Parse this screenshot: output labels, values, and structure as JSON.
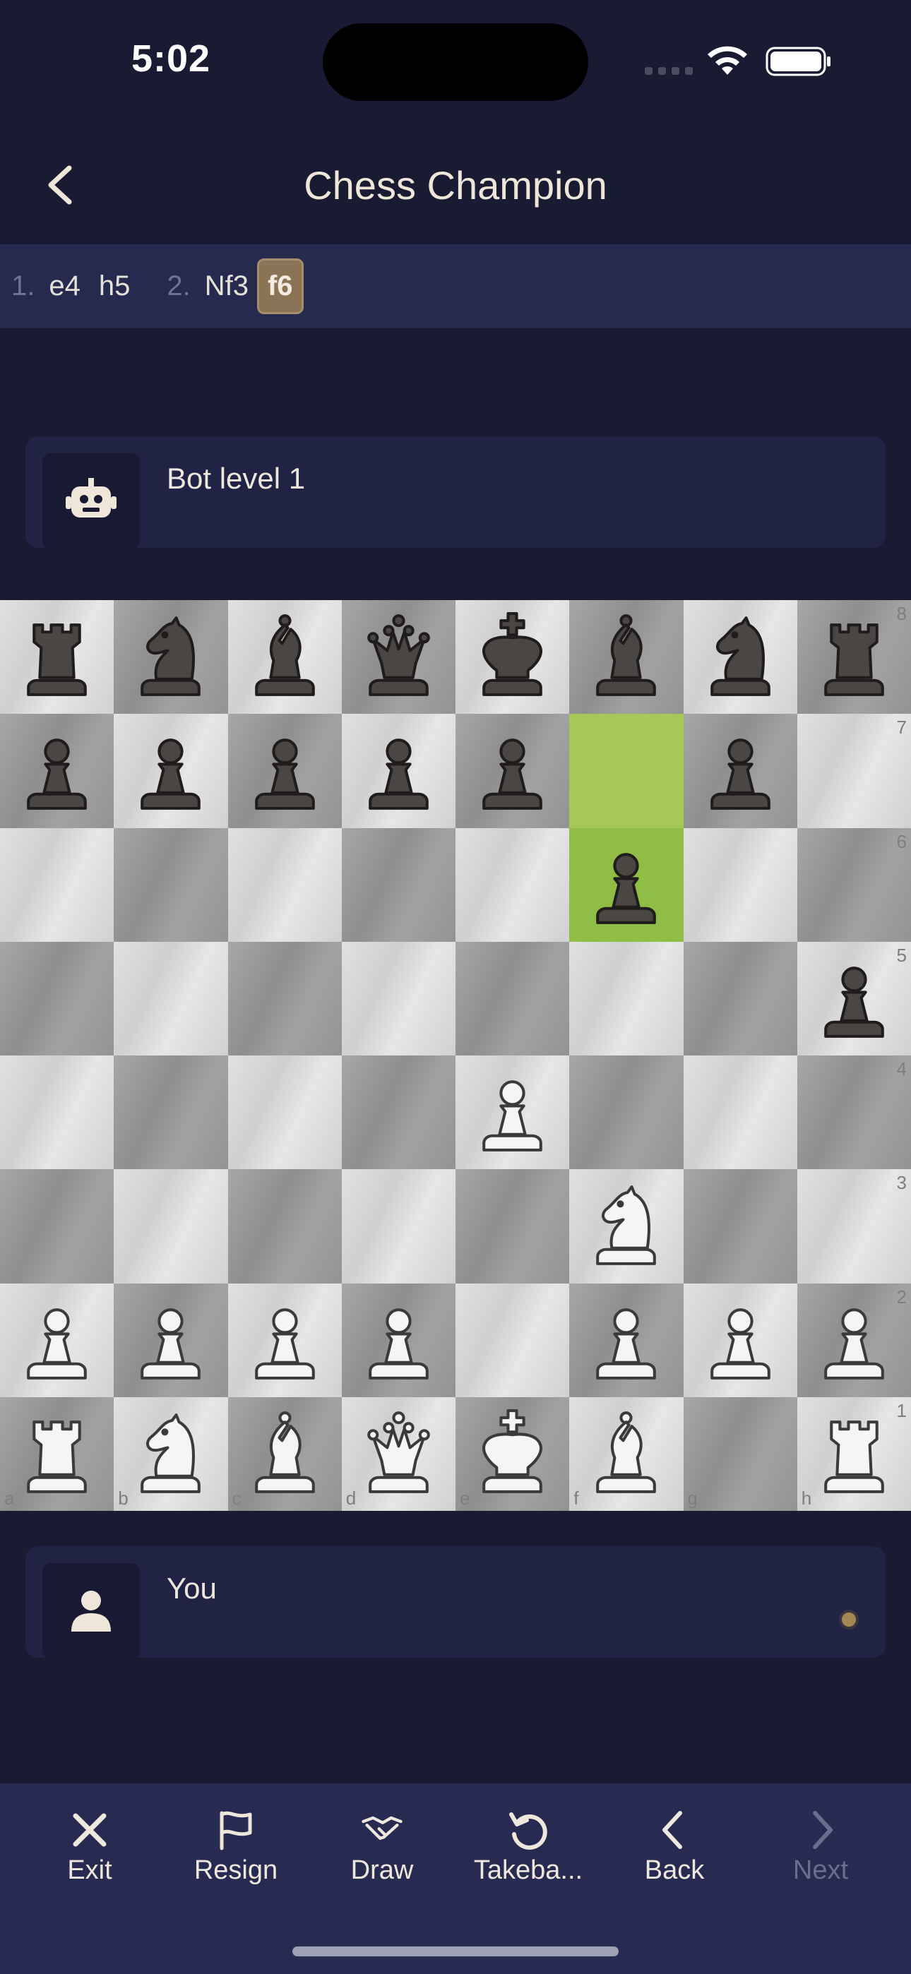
{
  "status": {
    "time": "5:02"
  },
  "nav": {
    "title": "Chess Champion"
  },
  "moves": [
    {
      "num": "1.",
      "white": "e4",
      "black": "h5"
    },
    {
      "num": "2.",
      "white": "Nf3",
      "black": "f6"
    }
  ],
  "opponent": {
    "name": "Bot level 1",
    "icon": "robot-icon"
  },
  "player": {
    "name": "You",
    "icon": "person-icon"
  },
  "board": {
    "ranks": [
      "8",
      "7",
      "6",
      "5",
      "4",
      "3",
      "2",
      "1"
    ],
    "files": [
      "a",
      "b",
      "c",
      "d",
      "e",
      "f",
      "g",
      "h"
    ],
    "position": [
      [
        "bR",
        "bN",
        "bB",
        "bQ",
        "bK",
        "bB",
        "bN",
        "bR"
      ],
      [
        "bP",
        "bP",
        "bP",
        "bP",
        "bP",
        "",
        "bP",
        ""
      ],
      [
        "",
        "",
        "",
        "",
        "",
        "bP",
        "",
        ""
      ],
      [
        "",
        "",
        "",
        "",
        "",
        "",
        "",
        "bP"
      ],
      [
        "",
        "",
        "",
        "",
        "wP",
        "",
        "",
        ""
      ],
      [
        "",
        "",
        "",
        "",
        "",
        "wN",
        "",
        ""
      ],
      [
        "wP",
        "wP",
        "wP",
        "wP",
        "",
        "wP",
        "wP",
        "wP"
      ],
      [
        "wR",
        "wN",
        "wB",
        "wQ",
        "wK",
        "wB",
        "",
        "wR"
      ]
    ],
    "last_move": [
      "f7",
      "f6"
    ],
    "highlight_color": "#a5c859"
  },
  "toolbar": {
    "exit": "Exit",
    "resign": "Resign",
    "draw": "Draw",
    "takeback": "Takeba...",
    "back": "Back",
    "next": "Next"
  },
  "colors": {
    "background": "#191b33",
    "bar": "#262a4f",
    "accent": "#8b7355"
  }
}
